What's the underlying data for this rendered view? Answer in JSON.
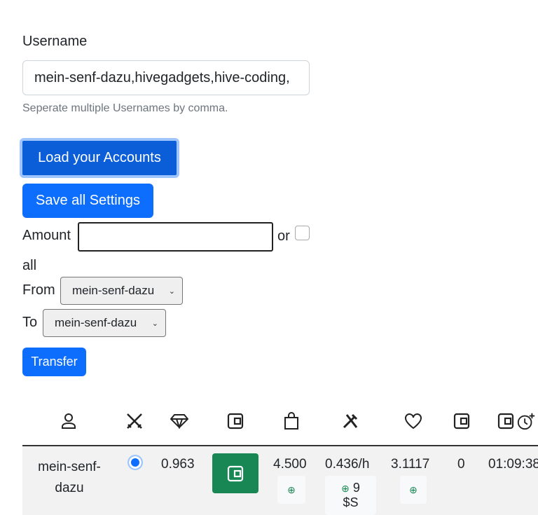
{
  "form": {
    "username_label": "Username",
    "username_value": "mein-senf-dazu,hivegadgets,hive-coding,",
    "username_help": "Seperate multiple Usernames by comma.",
    "load_button": "Load your Accounts",
    "save_button": "Save all Settings",
    "amount_label": "Amount",
    "amount_value": "",
    "or_label": "or",
    "all_label": "all",
    "all_checked": false,
    "from_label": "From",
    "from_value": "mein-senf-dazu",
    "to_label": "To",
    "to_value": "mein-senf-dazu",
    "transfer_button": "Transfer"
  },
  "table": {
    "header_icons": [
      "user-icon",
      "swords-off-icon",
      "diamond-icon",
      "wallet-icon",
      "shopping-bag-icon",
      "tools-icon",
      "heart-icon",
      "wallet-icon",
      "wallet-icon",
      "clock-plus-icon"
    ],
    "rows": [
      {
        "name": "mein-senf-dazu",
        "selected": true,
        "c1": "0.963",
        "c2": "4.500",
        "c3": "0.436/h",
        "c3_extra": "9",
        "c3_unit": "$S",
        "c4": "3.1117",
        "c5": "0",
        "c6": "01:09:38"
      }
    ]
  },
  "colors": {
    "primary": "#0d6efd",
    "success": "#198754"
  }
}
